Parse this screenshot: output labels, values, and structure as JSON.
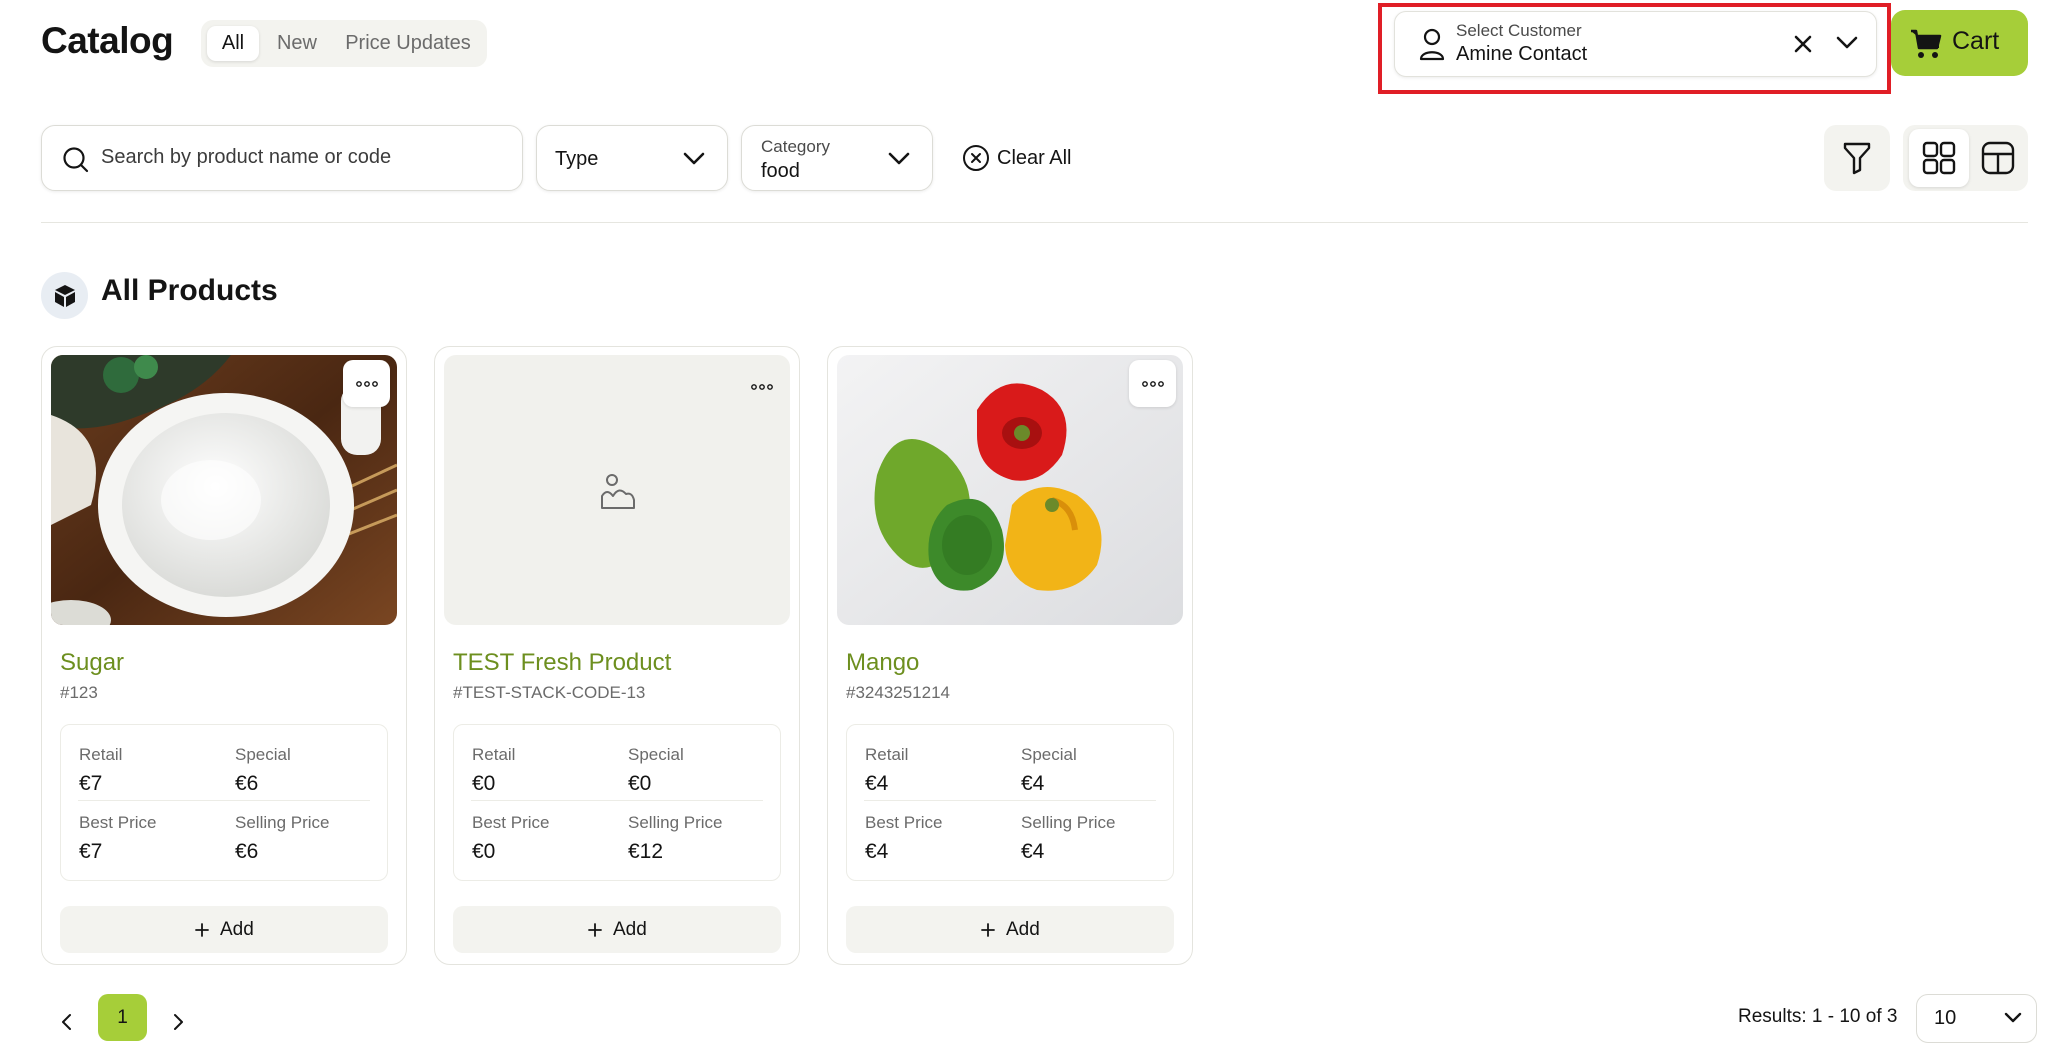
{
  "header": {
    "title": "Catalog",
    "tabs": [
      {
        "label": "All",
        "active": true
      },
      {
        "label": "New",
        "active": false
      },
      {
        "label": "Price Updates",
        "active": false
      }
    ],
    "customer": {
      "label": "Select Customer",
      "value": "Amine Contact"
    },
    "cart_label": "Cart"
  },
  "filters": {
    "search_placeholder": "Search by product name or code",
    "type_label": "Type",
    "category_label": "Category",
    "category_value": "food",
    "clear_all_label": "Clear All"
  },
  "section": {
    "title": "All Products"
  },
  "products": [
    {
      "name": "Sugar",
      "code": "#123",
      "image": "sugar-bowl-photo",
      "retail_label": "Retail",
      "retail": "€7",
      "special_label": "Special",
      "special": "€6",
      "best_label": "Best Price",
      "best": "€7",
      "selling_label": "Selling Price",
      "selling": "€6",
      "add_label": "Add"
    },
    {
      "name": "TEST Fresh Product",
      "code": "#TEST-STACK-CODE-13",
      "image": "placeholder-image-icon",
      "retail_label": "Retail",
      "retail": "€0",
      "special_label": "Special",
      "special": "€0",
      "best_label": "Best Price",
      "best": "€0",
      "selling_label": "Selling Price",
      "selling": "€12",
      "add_label": "Add"
    },
    {
      "name": "Mango",
      "code": "#3243251214",
      "image": "bell-peppers-photo",
      "retail_label": "Retail",
      "retail": "€4",
      "special_label": "Special",
      "special": "€4",
      "best_label": "Best Price",
      "best": "€4",
      "selling_label": "Selling Price",
      "selling": "€4",
      "add_label": "Add"
    }
  ],
  "pagination": {
    "current_page": "1",
    "results_text": "Results: 1 - 10 of 3",
    "per_page": "10"
  },
  "colors": {
    "accent": "#a6ce39",
    "product_name": "#6d8f1f",
    "highlight": "#e01e26"
  }
}
